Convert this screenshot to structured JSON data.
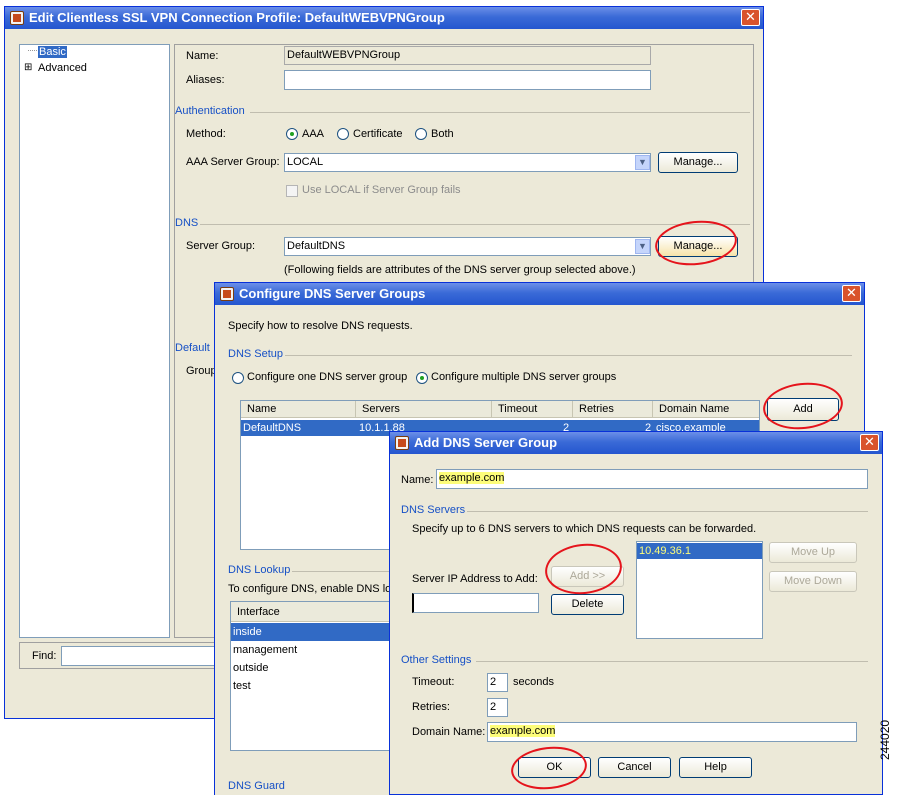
{
  "main_window": {
    "title": "Edit Clientless SSL VPN Connection Profile: DefaultWEBVPNGroup",
    "tree": {
      "basic": "Basic",
      "advanced": "Advanced",
      "expander": "⊞"
    },
    "name_label": "Name:",
    "name_value": "DefaultWEBVPNGroup",
    "aliases_label": "Aliases:",
    "authentication_heading": "Authentication",
    "method_label": "Method:",
    "method_options": [
      "AAA",
      "Certificate",
      "Both"
    ],
    "aaa_server_group_label": "AAA Server Group:",
    "aaa_server_group_value": "LOCAL",
    "manage_label": "Manage...",
    "use_local_label": "Use LOCAL if Server Group fails",
    "dns_heading": "DNS",
    "dns_server_group_label": "Server Group:",
    "dns_server_group_value": "DefaultDNS",
    "dns_manage_label": "Manage...",
    "dns_note": "(Following fields are attributes of the DNS server group selected above.)",
    "default_heading_partial": "Default",
    "group_partial": "Group",
    "find_label": "Find:"
  },
  "dns_groups_dialog": {
    "title": "Configure DNS Server Groups",
    "intro": "Specify how to resolve DNS requests.",
    "setup_heading": "DNS Setup",
    "option_one": "Configure one DNS server group",
    "option_multiple": "Configure multiple DNS server groups",
    "columns": [
      "Name",
      "Servers",
      "Timeout",
      "Retries",
      "Domain Name"
    ],
    "rows": [
      {
        "name": "DefaultDNS",
        "servers": "10.1.1.88",
        "timeout": "2",
        "retries": "2",
        "domain": "cisco.example"
      }
    ],
    "add_label": "Add",
    "lookup_heading": "DNS Lookup",
    "lookup_note": "To configure DNS, enable DNS loo",
    "interface_header": "Interface",
    "interfaces": [
      "inside",
      "management",
      "outside",
      "test"
    ],
    "guard_heading": "DNS Guard"
  },
  "add_dns_dialog": {
    "title": "Add DNS Server Group",
    "name_label": "Name:",
    "name_value": "example.com",
    "servers_heading": "DNS Servers",
    "servers_note": "Specify up to 6 DNS servers to which DNS requests can be forwarded.",
    "ip_label": "Server IP Address to Add:",
    "ip_value": "",
    "add_btn": "Add >>",
    "delete_btn": "Delete",
    "servers_list": [
      "10.49.36.1"
    ],
    "move_up": "Move Up",
    "move_down": "Move Down",
    "other_heading": "Other Settings",
    "timeout_label": "Timeout:",
    "timeout_value": "2",
    "seconds_label": "seconds",
    "retries_label": "Retries:",
    "retries_value": "2",
    "domain_label": "Domain Name:",
    "domain_value": "example.com",
    "ok": "OK",
    "cancel": "Cancel",
    "help": "Help"
  },
  "figure_id": "244020",
  "colors": {
    "title_blue": "#2456cf",
    "annotation_red": "#e5141c",
    "highlight_yellow": "#fdfd7a",
    "selection": "#316ac5"
  }
}
